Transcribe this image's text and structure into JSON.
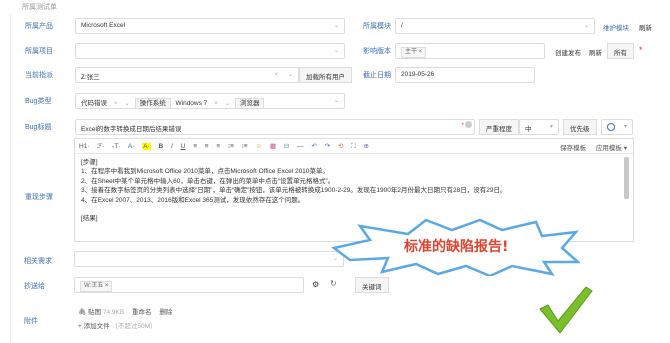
{
  "top": {
    "text": "所属测试单"
  },
  "fields": {
    "product": {
      "label": "所属产品",
      "value": "Microsoft Excel"
    },
    "module": {
      "label": "所属模块",
      "value": "/",
      "links": [
        "维护模块",
        "刷新"
      ]
    },
    "project": {
      "label": "所属项目",
      "value": ""
    },
    "build": {
      "label": "影响版本",
      "tag": "主干",
      "links": [
        "创建发布",
        "刷新",
        "所有"
      ]
    },
    "assigned": {
      "label": "当前指派",
      "value": "Z:张三",
      "addon": "加载所有用户"
    },
    "deadline": {
      "label": "截止日期",
      "value": "2019-05-26"
    },
    "bugtype": {
      "label": "Bug类型",
      "type_value": "代码错误",
      "os_label": "操作系统",
      "os_value": "Windows 7",
      "browser_label": "浏览器"
    },
    "title": {
      "label": "Bug标题",
      "value": "Excel的数字转换成日期后结果错误",
      "severity_label": "严重程度",
      "severity_value": "中",
      "priority_label": "优先级"
    },
    "steps": {
      "label": "重现步骤"
    },
    "story": {
      "label": "相关需求"
    },
    "cc": {
      "label": "抄送给",
      "tag": "W:王五",
      "keyword_label": "关键词"
    },
    "files": {
      "label": "附件"
    }
  },
  "editor": {
    "toolbar": [
      "H1·",
      "ℱ·",
      "ₜT·",
      "A·",
      "A·",
      "B",
      "I",
      "U",
      "≡",
      "≡",
      "≡",
      "⁝≡",
      "⁝≡",
      "☺",
      "▦",
      "⊟",
      "—",
      "↶",
      "↷",
      "⟲",
      "⛶",
      "⊕"
    ],
    "toolbar_right": [
      "保存模板",
      "应用模板 ▾"
    ],
    "lines": [
      "[步骤]",
      "1、在程序中看我到Microsoft Office 2010菜单，点击Microsoft Office Excel 2010菜单。",
      "2、在Sheet中某个单元格中输入60，单击右键，在弹出的菜单中点击“设置单元格格式”。",
      "3、接着在数字标签页的分类列表中选择“日期”，单击“确定”按钮，该单元格被转换成1900-2-29。发现在1900年2月份最大日期只有28日，没有29日。",
      "4、在Excel 2007、2013、2016版和Excel 365测试，发现依然存在这个问题。",
      "",
      "[结果]"
    ]
  },
  "attachments": {
    "file_name": "贴图",
    "file_size": "74.9KB",
    "rename": "重命名",
    "delete": "删除",
    "add_file": "+ 添加文件",
    "limit": "（不超过50M）"
  },
  "annotation": {
    "text": "标准的缺陷报告!"
  },
  "colors": {
    "label_blue": "#3c6fb4",
    "callout_red": "#e2432f",
    "check_green": "#7bbf2a"
  }
}
